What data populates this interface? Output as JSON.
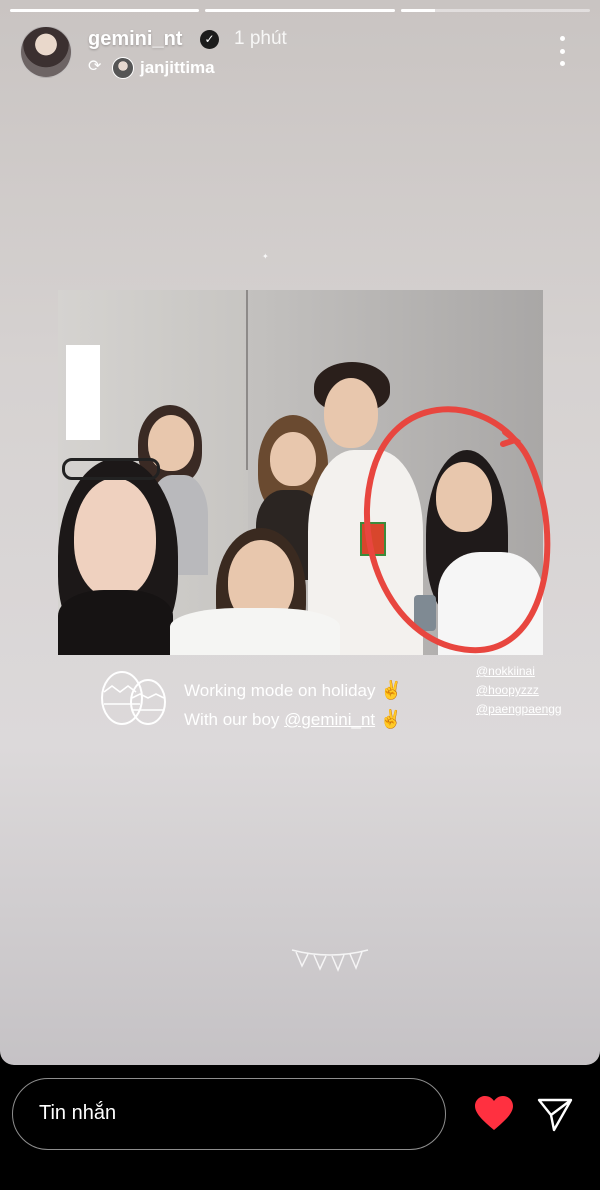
{
  "progress": [
    1,
    1,
    0.18
  ],
  "header": {
    "username": "gemini_nt",
    "time": "1 phút",
    "reposted_from": "janjittima",
    "icons": [
      "verified-badge",
      "repost-icon",
      "more-icon"
    ]
  },
  "caption": {
    "line1": "Working mode on holiday",
    "line2_prefix": "With our boy ",
    "mention": "@gemini_nt",
    "emoji": "✌️"
  },
  "tags": [
    "@nokkiinai",
    "@hoopyzzz",
    "@paengpaengg"
  ],
  "annotation_color": "#e8463f",
  "bottom": {
    "message_placeholder": "Tin nhắn",
    "like_color": "#ff3040"
  }
}
